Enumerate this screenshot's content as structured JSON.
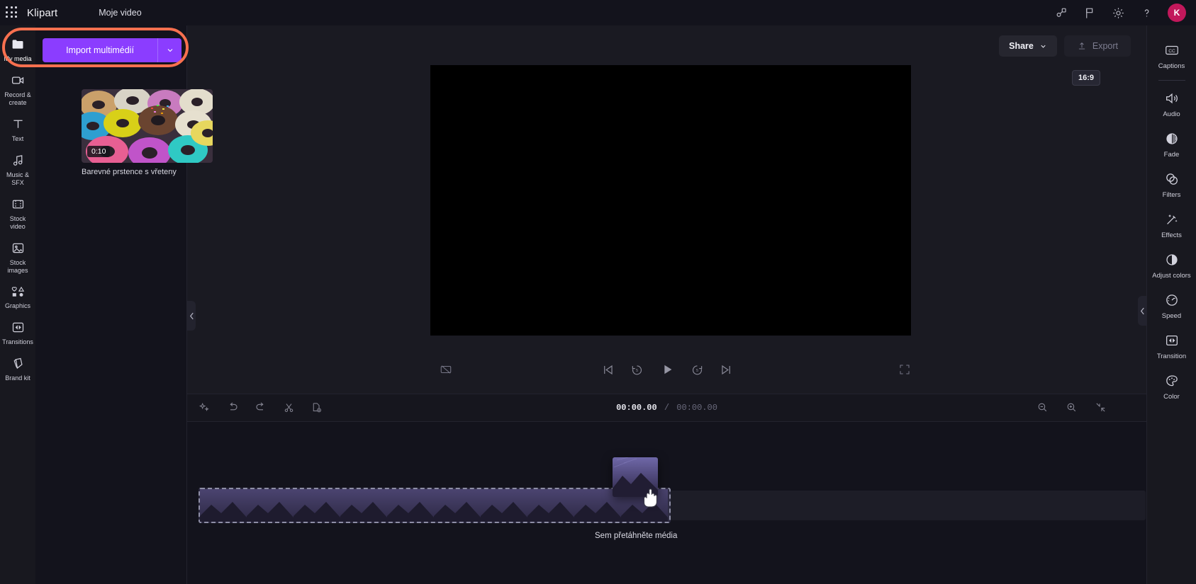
{
  "app": {
    "brand": "Klipart",
    "project_title": "Moje video",
    "accent_color": "#8b3dff",
    "highlight_color": "#f8704f",
    "avatar_initial": "K",
    "avatar_color": "#c2185b"
  },
  "topbar": {
    "icons": [
      {
        "name": "apps-grid-icon",
        "label": "Apps"
      },
      {
        "name": "share-node-icon",
        "label": "Collaborate"
      },
      {
        "name": "flag-icon",
        "label": "Feedback"
      },
      {
        "name": "gear-icon",
        "label": "Settings"
      },
      {
        "name": "help-icon",
        "label": "Help"
      }
    ]
  },
  "header_actions": {
    "share_label": "Share",
    "export_label": "Export"
  },
  "sidebar": {
    "items": [
      {
        "label": "My media",
        "icon": "folder-icon",
        "active": true
      },
      {
        "label": "Record & create",
        "icon": "record-camera-icon",
        "active": false
      },
      {
        "label": "Text",
        "icon": "text-icon",
        "active": false
      },
      {
        "label": "Music & SFX",
        "icon": "music-note-icon",
        "active": false
      },
      {
        "label": "Stock video",
        "icon": "film-strip-icon",
        "active": false
      },
      {
        "label": "Stock images",
        "icon": "image-icon",
        "active": false
      },
      {
        "label": "Graphics",
        "icon": "shapes-icon",
        "active": false
      },
      {
        "label": "Transitions",
        "icon": "transition-icon",
        "active": false
      },
      {
        "label": "Brand kit",
        "icon": "brand-kit-icon",
        "active": false
      }
    ]
  },
  "media_panel": {
    "import_label": "Import multimédií",
    "import_caret_icon": "chevron-down-icon",
    "items": [
      {
        "title": "Barevné prstence s vřeteny",
        "duration": "0:10"
      }
    ]
  },
  "preview": {
    "aspect_ratio": "16:9",
    "controls": [
      {
        "name": "captions-off-icon",
        "label": "Captions off"
      },
      {
        "name": "skip-start-icon",
        "label": "Jump to start"
      },
      {
        "name": "rewind-5s-icon",
        "label": "Back 5 seconds"
      },
      {
        "name": "play-icon",
        "label": "Play"
      },
      {
        "name": "forward-5s-icon",
        "label": "Forward 5 seconds"
      },
      {
        "name": "skip-end-icon",
        "label": "Jump to end"
      },
      {
        "name": "fullscreen-icon",
        "label": "Fullscreen"
      }
    ]
  },
  "timeline": {
    "tools": [
      {
        "name": "magic-sparkle-icon",
        "label": "Magic tools"
      },
      {
        "name": "undo-icon",
        "label": "Undo"
      },
      {
        "name": "redo-icon",
        "label": "Redo"
      },
      {
        "name": "split-scissors-icon",
        "label": "Split"
      },
      {
        "name": "duplicate-icon",
        "label": "Duplicate"
      }
    ],
    "current_time": "00:00.00",
    "separator": "/",
    "total_time": "00:00.00",
    "zoom_controls": [
      {
        "name": "zoom-out-icon",
        "label": "Zoom out"
      },
      {
        "name": "zoom-in-icon",
        "label": "Zoom in"
      },
      {
        "name": "fit-to-screen-icon",
        "label": "Fit to screen"
      }
    ],
    "drop_hint": "Sem přetáhněte média",
    "ghost_frame_count": 10
  },
  "right_panel": {
    "items": [
      {
        "label": "Captions",
        "icon": "cc-icon",
        "divider_after": true
      },
      {
        "label": "Audio",
        "icon": "speaker-icon",
        "divider_after": false
      },
      {
        "label": "Fade",
        "icon": "fade-circle-icon",
        "divider_after": false
      },
      {
        "label": "Filters",
        "icon": "filters-circles-icon",
        "divider_after": false
      },
      {
        "label": "Effects",
        "icon": "effects-wand-icon",
        "divider_after": false
      },
      {
        "label": "Adjust colors",
        "icon": "contrast-icon",
        "divider_after": false
      },
      {
        "label": "Speed",
        "icon": "speedometer-icon",
        "divider_after": false
      },
      {
        "label": "Transition",
        "icon": "transition-icon",
        "divider_after": false
      },
      {
        "label": "Color",
        "icon": "palette-icon",
        "divider_after": false
      }
    ]
  }
}
